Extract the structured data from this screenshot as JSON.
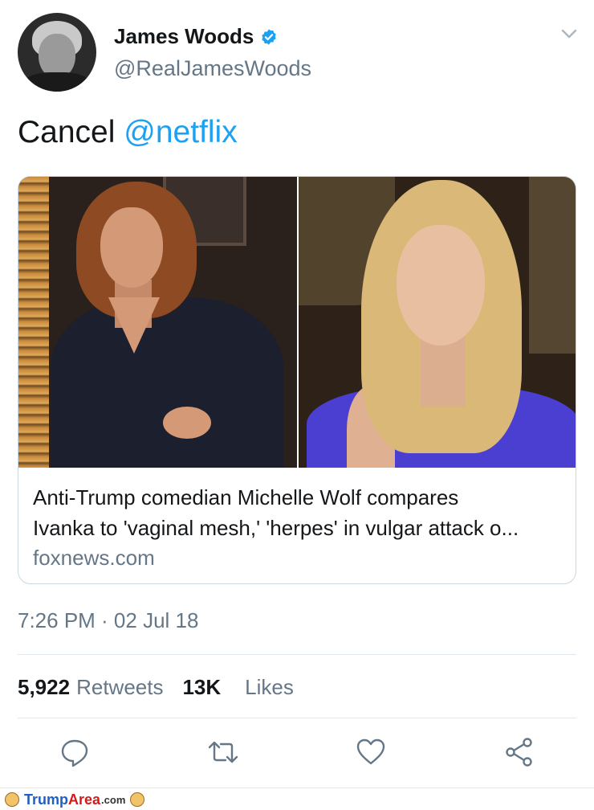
{
  "author": {
    "display_name": "James Woods",
    "handle": "@RealJamesWoods",
    "verified": true
  },
  "tweet": {
    "text_prefix": "Cancel ",
    "mention": "@netflix"
  },
  "link_card": {
    "title_line1": "Anti-Trump comedian Michelle Wolf compares",
    "title_line2": "Ivanka to 'vaginal mesh,' 'herpes' in vulgar attack o...",
    "domain": "foxnews.com"
  },
  "timestamp": "7:26 PM · 02 Jul 18",
  "stats": {
    "retweets_count": "5,922",
    "retweets_label": "Retweets",
    "likes_count": "13K",
    "likes_label": "Likes"
  },
  "actions": [
    {
      "icon": "reply-icon"
    },
    {
      "icon": "retweet-icon"
    },
    {
      "icon": "like-icon"
    },
    {
      "icon": "share-icon"
    }
  ],
  "watermark": {
    "part1": "Trump",
    "part2": "Area",
    "suffix": ".com"
  },
  "colors": {
    "link_blue": "#1da1f2",
    "secondary_text": "#657786",
    "border": "#ccd6dd",
    "verified_blue": "#1da1f2"
  }
}
